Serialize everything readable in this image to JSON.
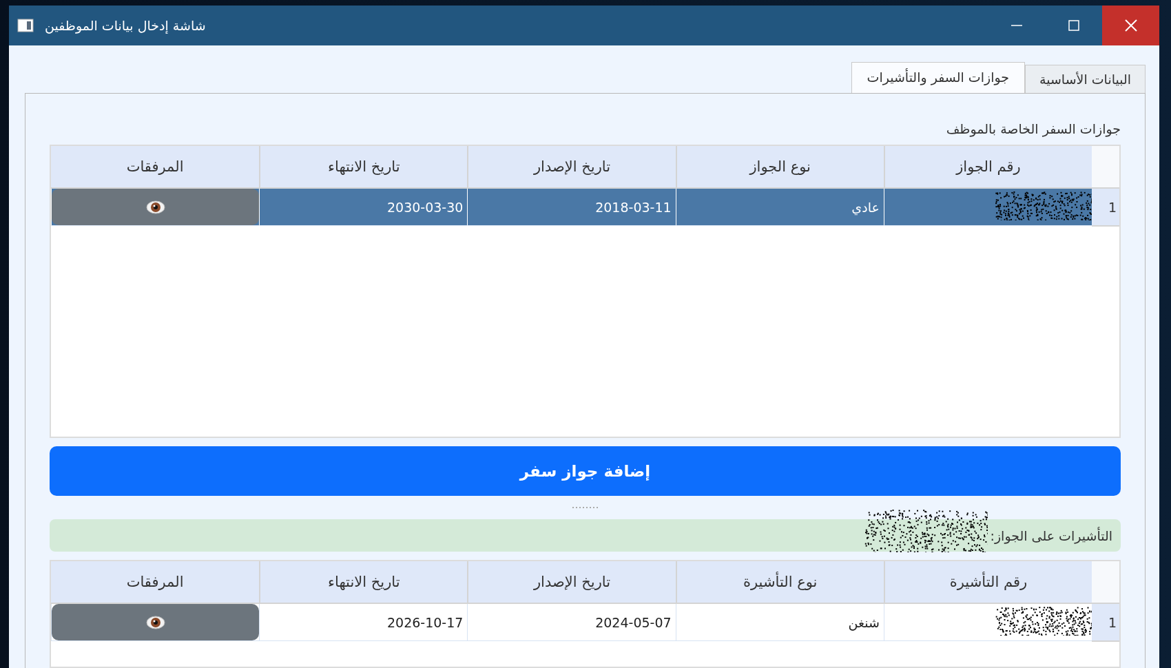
{
  "window": {
    "title": "شاشة إدخال بيانات الموظفين"
  },
  "tabs": [
    {
      "label": "البيانات الأساسية",
      "selected": false
    },
    {
      "label": "جوازات السفر والتأشيرات",
      "selected": true
    }
  ],
  "passports": {
    "label": "جوازات السفر الخاصة بالموظف",
    "columns": [
      "رقم الجواز",
      "نوع الجواز",
      "تاريخ الإصدار",
      "تاريخ الانتهاء",
      "المرفقات"
    ],
    "rows": [
      {
        "row_number": "1",
        "selected": true,
        "cells": [
          {
            "kind": "redacted"
          },
          {
            "kind": "text",
            "text": "عادي"
          },
          {
            "kind": "text",
            "text": "2018-03-11"
          },
          {
            "kind": "text",
            "text": "2030-03-30"
          },
          {
            "kind": "attachment"
          }
        ]
      }
    ]
  },
  "add_passport_button": "إضافة جواز سفر",
  "visas": {
    "label": "التأشيرات على الجواز:",
    "columns": [
      "رقم التأشيرة",
      "نوع التأشيرة",
      "تاريخ الإصدار",
      "تاريخ الانتهاء",
      "المرفقات"
    ],
    "rows": [
      {
        "row_number": "1",
        "selected": false,
        "cells": [
          {
            "kind": "redacted"
          },
          {
            "kind": "text",
            "text": "شنغن"
          },
          {
            "kind": "text",
            "text": "2024-05-07"
          },
          {
            "kind": "text",
            "text": "2026-10-17"
          },
          {
            "kind": "attachment"
          }
        ]
      }
    ]
  }
}
